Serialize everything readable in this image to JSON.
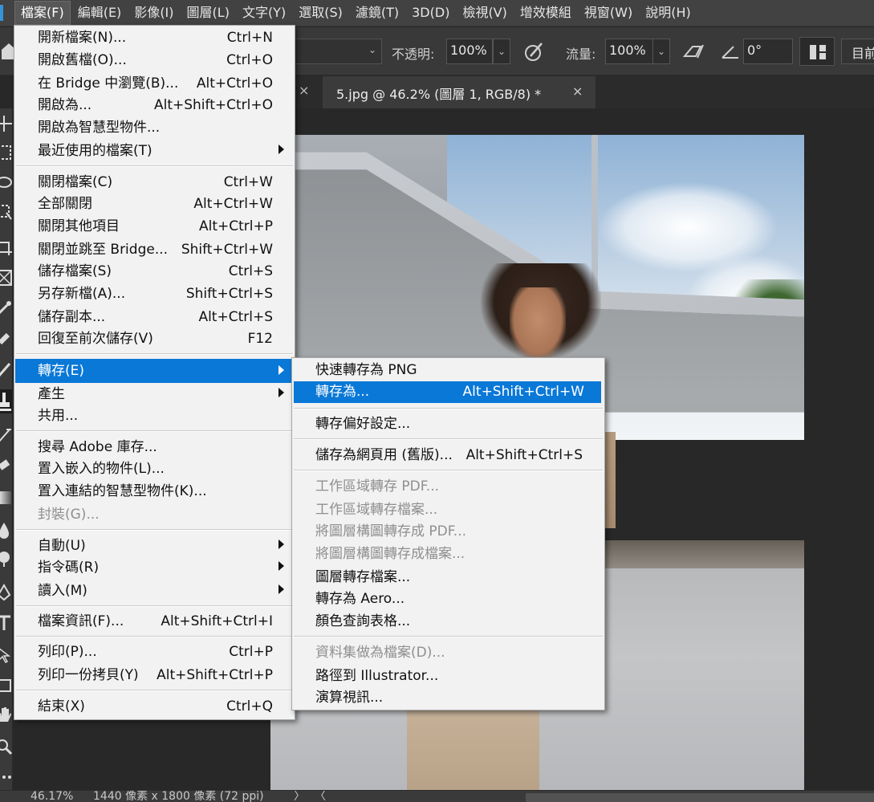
{
  "menubar": {
    "items": [
      "檔案(F)",
      "編輯(E)",
      "影像(I)",
      "圖層(L)",
      "文字(Y)",
      "選取(S)",
      "濾鏡(T)",
      "3D(D)",
      "檢視(V)",
      "增效模組",
      "視窗(W)",
      "說明(H)"
    ]
  },
  "optionsbar": {
    "opacity_label": "不透明:",
    "opacity_value": "100%",
    "flow_label": "流量:",
    "flow_value": "100%",
    "angle_value": "0°",
    "workspace_label": "目前"
  },
  "document_tab": {
    "title": "5.jpg @ 46.2% (圖層 1, RGB/8) *",
    "close_symbol": "×",
    "prev_tab_close_symbol": "×"
  },
  "file_menu": {
    "items": [
      {
        "label": "開新檔案(N)...",
        "shortcut": "Ctrl+N"
      },
      {
        "label": "開啟舊檔(O)...",
        "shortcut": "Ctrl+O"
      },
      {
        "label": "在 Bridge 中瀏覽(B)...",
        "shortcut": "Alt+Ctrl+O"
      },
      {
        "label": "開啟為...",
        "shortcut": "Alt+Shift+Ctrl+O"
      },
      {
        "label": "開啟為智慧型物件...",
        "shortcut": ""
      },
      {
        "label": "最近使用的檔案(T)",
        "shortcut": ""
      },
      {
        "label": "關閉檔案(C)",
        "shortcut": "Ctrl+W"
      },
      {
        "label": "全部關閉",
        "shortcut": "Alt+Ctrl+W"
      },
      {
        "label": "關閉其他項目",
        "shortcut": "Alt+Ctrl+P"
      },
      {
        "label": "關閉並跳至 Bridge...",
        "shortcut": "Shift+Ctrl+W"
      },
      {
        "label": "儲存檔案(S)",
        "shortcut": "Ctrl+S"
      },
      {
        "label": "另存新檔(A)...",
        "shortcut": "Shift+Ctrl+S"
      },
      {
        "label": "儲存副本...",
        "shortcut": "Alt+Ctrl+S"
      },
      {
        "label": "回復至前次儲存(V)",
        "shortcut": "F12"
      },
      {
        "label": "轉存(E)",
        "shortcut": ""
      },
      {
        "label": "產生",
        "shortcut": ""
      },
      {
        "label": "共用...",
        "shortcut": ""
      },
      {
        "label": "搜尋 Adobe 庫存...",
        "shortcut": ""
      },
      {
        "label": "置入嵌入的物件(L)...",
        "shortcut": ""
      },
      {
        "label": "置入連結的智慧型物件(K)...",
        "shortcut": ""
      },
      {
        "label": "封裝(G)...",
        "shortcut": ""
      },
      {
        "label": "自動(U)",
        "shortcut": ""
      },
      {
        "label": "指令碼(R)",
        "shortcut": ""
      },
      {
        "label": "讀入(M)",
        "shortcut": ""
      },
      {
        "label": "檔案資訊(F)...",
        "shortcut": "Alt+Shift+Ctrl+I"
      },
      {
        "label": "列印(P)...",
        "shortcut": "Ctrl+P"
      },
      {
        "label": "列印一份拷貝(Y)",
        "shortcut": "Alt+Shift+Ctrl+P"
      },
      {
        "label": "結束(X)",
        "shortcut": "Ctrl+Q"
      }
    ]
  },
  "export_menu": {
    "items": [
      {
        "label": "快速轉存為 PNG",
        "shortcut": ""
      },
      {
        "label": "轉存為...",
        "shortcut": "Alt+Shift+Ctrl+W"
      },
      {
        "label": "轉存偏好設定...",
        "shortcut": ""
      },
      {
        "label": "儲存為網頁用 (舊版)...",
        "shortcut": "Alt+Shift+Ctrl+S"
      },
      {
        "label": "工作區域轉存 PDF...",
        "shortcut": ""
      },
      {
        "label": "工作區域轉存檔案...",
        "shortcut": ""
      },
      {
        "label": "將圖層構圖轉存成 PDF...",
        "shortcut": ""
      },
      {
        "label": "將圖層構圖轉存成檔案...",
        "shortcut": ""
      },
      {
        "label": "圖層轉存檔案...",
        "shortcut": ""
      },
      {
        "label": "轉存為 Aero...",
        "shortcut": ""
      },
      {
        "label": "顏色查詢表格...",
        "shortcut": ""
      },
      {
        "label": "資料集做為檔案(D)...",
        "shortcut": ""
      },
      {
        "label": "路徑到 Illustrator...",
        "shortcut": ""
      },
      {
        "label": "演算視訊...",
        "shortcut": ""
      }
    ]
  },
  "statusbar": {
    "zoom": "46.17%",
    "doc_info": "1440 像素 x 1800 像素 (72 ppi)",
    "more_arrow": "〉",
    "scroll_left": "〈"
  },
  "colors": {
    "highlight": "#0a78d7",
    "menu_bg": "#f2f2f2",
    "app_bg": "#282828"
  }
}
